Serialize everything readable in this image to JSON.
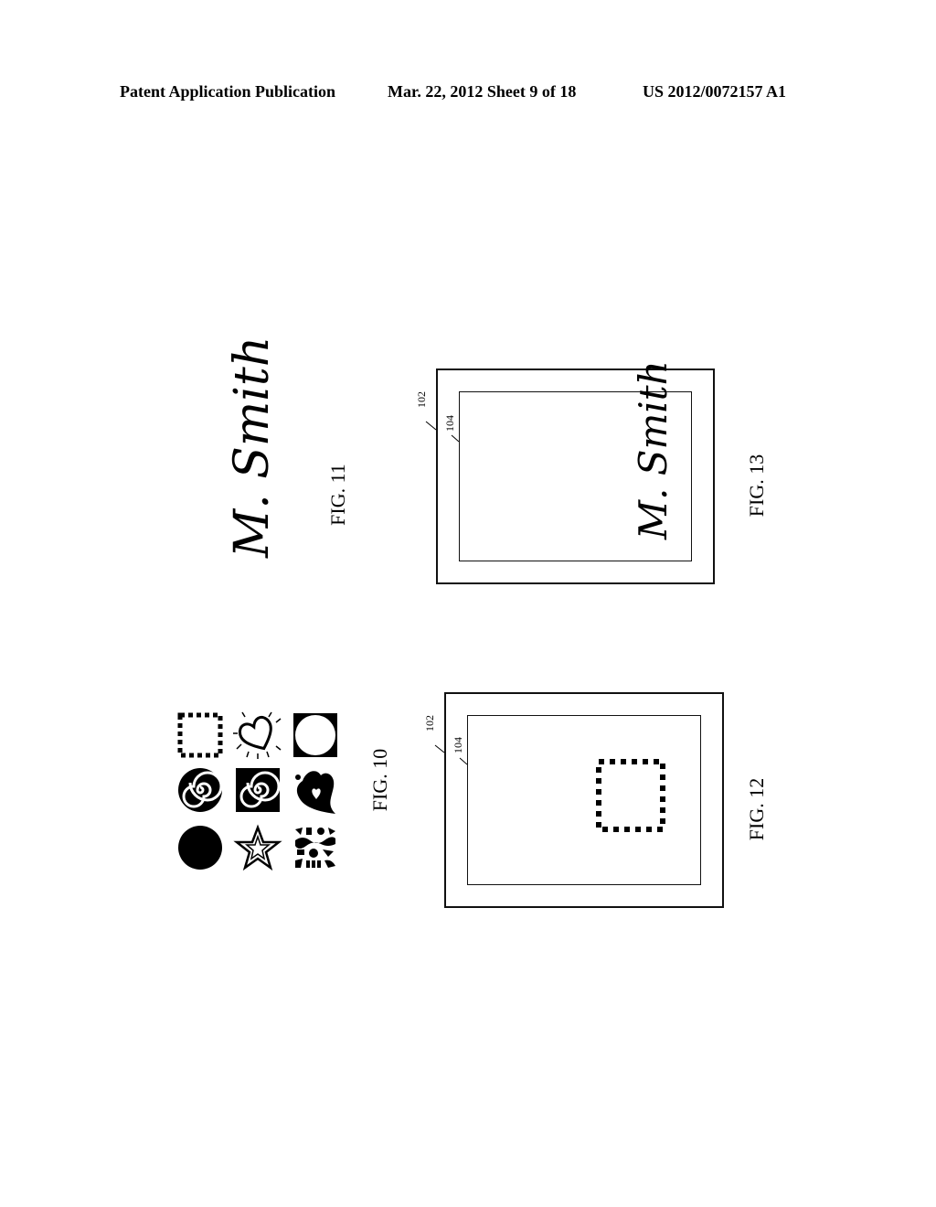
{
  "header": {
    "publication_type": "Patent Application Publication",
    "date_sheet": "Mar. 22, 2012  Sheet 9 of 18",
    "publication_number": "US 2012/0072157 A1"
  },
  "figures": {
    "fig10": {
      "label": "FIG. 10",
      "icons": [
        "dotted-square-icon",
        "sunburst-heart-icon",
        "circle-in-square-icon",
        "spiral-icon",
        "spiral-in-square-icon",
        "leaf-heart-icon",
        "filled-circle-icon",
        "star-icon",
        "patterned-square-icon"
      ]
    },
    "fig11": {
      "label": "FIG. 11",
      "signature": "M. Smith"
    },
    "fig12": {
      "label": "FIG. 12",
      "ref_outer": "102",
      "ref_inner": "104"
    },
    "fig13": {
      "label": "FIG. 13",
      "ref_outer": "102",
      "ref_inner": "104",
      "signature": "M. Smith"
    }
  }
}
